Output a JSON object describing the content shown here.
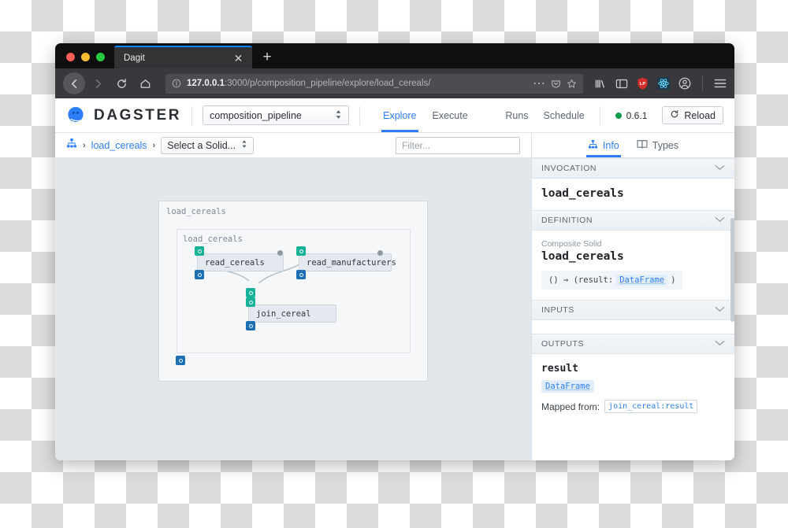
{
  "browser": {
    "tab": {
      "title": "Dagit",
      "close_icon": "close-icon"
    },
    "new_tab_label": "+",
    "url": {
      "bold": "127.0.0.1",
      "rest": ":3000/p/composition_pipeline/explore/load_cereals/"
    },
    "nav_icons": [
      "back-icon",
      "forward-icon",
      "reload-icon",
      "home-icon"
    ],
    "url_icons": [
      "page-info-icon",
      "more-icon",
      "pocket-icon",
      "bookmark-star-icon"
    ],
    "toolbar_icons": [
      "library-icon",
      "sidebar-icon",
      "lastpass-icon",
      "react-devtools-icon",
      "account-icon",
      "app-menu-icon"
    ]
  },
  "appbar": {
    "brand": "DAGSTER",
    "pipeline_selected": "composition_pipeline",
    "nav": [
      {
        "label": "Explore",
        "active": true
      },
      {
        "label": "Execute",
        "active": false
      }
    ],
    "right_nav": [
      {
        "label": "Runs"
      },
      {
        "label": "Schedule"
      }
    ],
    "version": "0.6.1",
    "version_status_color": "#0a9a4a",
    "reload_label": "Reload"
  },
  "toolbar": {
    "breadcrumb_icon": "pipeline-graph-icon",
    "breadcrumb_sep": "›",
    "breadcrumb_link": "load_cereals",
    "solid_select_label": "Select a Solid...",
    "filter_placeholder": "Filter..."
  },
  "graph": {
    "root_label": "load_cereals",
    "inner_label": "load_cereals",
    "nodes": [
      {
        "id": "read_cereals",
        "label": "read_cereals"
      },
      {
        "id": "read_manufacturers",
        "label": "read_manufacturers"
      },
      {
        "id": "join_cereal",
        "label": "join_cereal"
      }
    ],
    "port_in_color": "#16b398",
    "port_out_color": "#1b6fb5"
  },
  "sidebar": {
    "tabs": [
      {
        "label": "Info",
        "icon": "pipeline-graph-icon",
        "active": true
      },
      {
        "label": "Types",
        "icon": "book-icon",
        "active": false
      }
    ],
    "invocation": {
      "section": "INVOCATION",
      "name": "load_cereals"
    },
    "definition": {
      "section": "DEFINITION",
      "kind": "Composite Solid",
      "name": "load_cereals",
      "signature_prefix": "() ⇒ (result:",
      "signature_type": "DataFrame",
      "signature_suffix": ")"
    },
    "inputs": {
      "section": "INPUTS"
    },
    "outputs": {
      "section": "OUTPUTS",
      "name": "result",
      "type": "DataFrame",
      "mapped_label": "Mapped from:",
      "mapped_value": "join_cereal:result"
    },
    "chevron": "chevron-down-icon"
  }
}
